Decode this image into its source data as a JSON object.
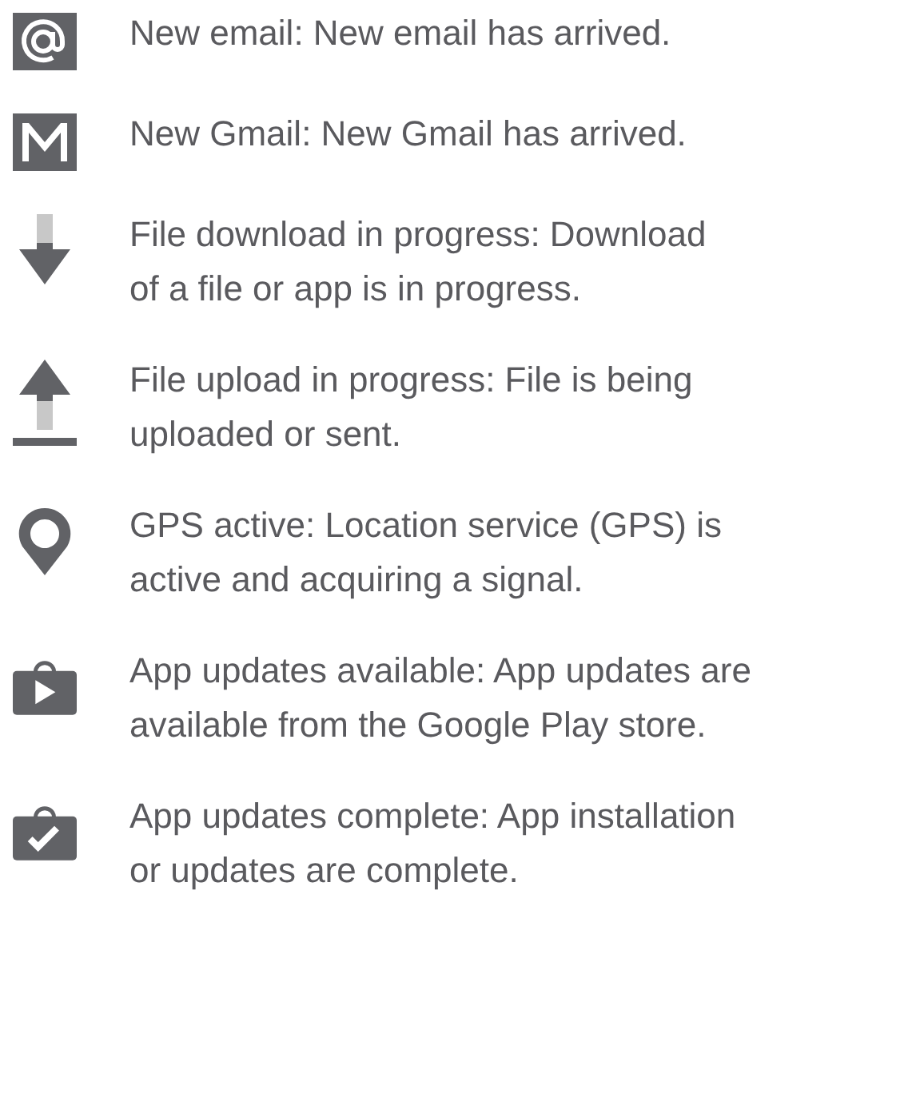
{
  "items": [
    {
      "kind": "email",
      "lines": [
        "New email: New email has arrived."
      ]
    },
    {
      "kind": "gmail",
      "lines": [
        "New Gmail: New Gmail has arrived."
      ]
    },
    {
      "kind": "download",
      "lines": [
        "File download in progress: Download",
        "of a file or app is in progress."
      ]
    },
    {
      "kind": "upload",
      "lines": [
        "File upload in progress: File is being",
        "uploaded or sent."
      ]
    },
    {
      "kind": "gps",
      "lines": [
        "GPS active: Location service (GPS) is",
        "active and acquiring a signal."
      ]
    },
    {
      "kind": "updates-available",
      "lines": [
        "App updates available: App updates are",
        "available from the Google Play store."
      ]
    },
    {
      "kind": "updates-complete",
      "lines": [
        "App updates complete: App installation",
        "or updates are complete."
      ]
    }
  ]
}
